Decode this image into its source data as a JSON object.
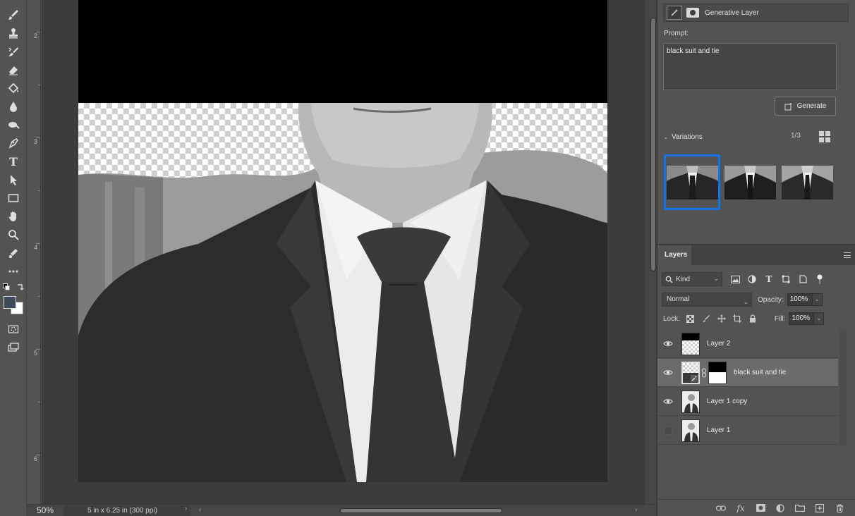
{
  "app": {
    "window": "Photoshop"
  },
  "toolbar": {
    "tools": [
      "brush-icon",
      "clone-stamp-icon",
      "history-brush-icon",
      "eraser-icon",
      "paint-bucket-icon",
      "blur-drop-icon",
      "dodge-icon",
      "pen-icon",
      "type-icon",
      "path-selection-icon",
      "rectangle-icon",
      "hand-icon",
      "zoom-icon",
      "edit-toolbar-icon",
      "more-icon"
    ],
    "type_tool_label": "T",
    "foreground_color": "#3b4a56",
    "background_color": "#ffffff"
  },
  "ruler": {
    "marks": [
      "2",
      "3",
      "4",
      "5",
      "6"
    ]
  },
  "status": {
    "zoom": "50%",
    "doc_info": "5 in x 6.25 in (300 ppi)"
  },
  "properties": {
    "panel_title": "Generative Layer",
    "prompt_label": "Prompt:",
    "prompt_value": "black suit and tie",
    "generate_label": "Generate",
    "variations_label": "Variations",
    "variation_counter": "1/3",
    "selected_variation_index": 0,
    "accent_color": "#1473e6"
  },
  "layers": {
    "tab_label": "Layers",
    "filter_kind": "Kind",
    "blend_mode": "Normal",
    "opacity_label": "Opacity:",
    "opacity_value": "100%",
    "lock_label": "Lock:",
    "fill_label": "Fill:",
    "fill_value": "100%",
    "items": [
      {
        "name": "Layer 2",
        "visible": true,
        "active": false
      },
      {
        "name": "black suit and tie",
        "visible": true,
        "active": true
      },
      {
        "name": "Layer 1 copy",
        "visible": true,
        "active": false
      },
      {
        "name": "Layer 1",
        "visible": false,
        "active": false
      }
    ],
    "footer_icons": [
      "link-layers-icon",
      "fx-icon",
      "add-mask-icon",
      "adjustment-layer-icon",
      "new-group-icon",
      "new-layer-icon",
      "delete-layer-icon"
    ]
  }
}
